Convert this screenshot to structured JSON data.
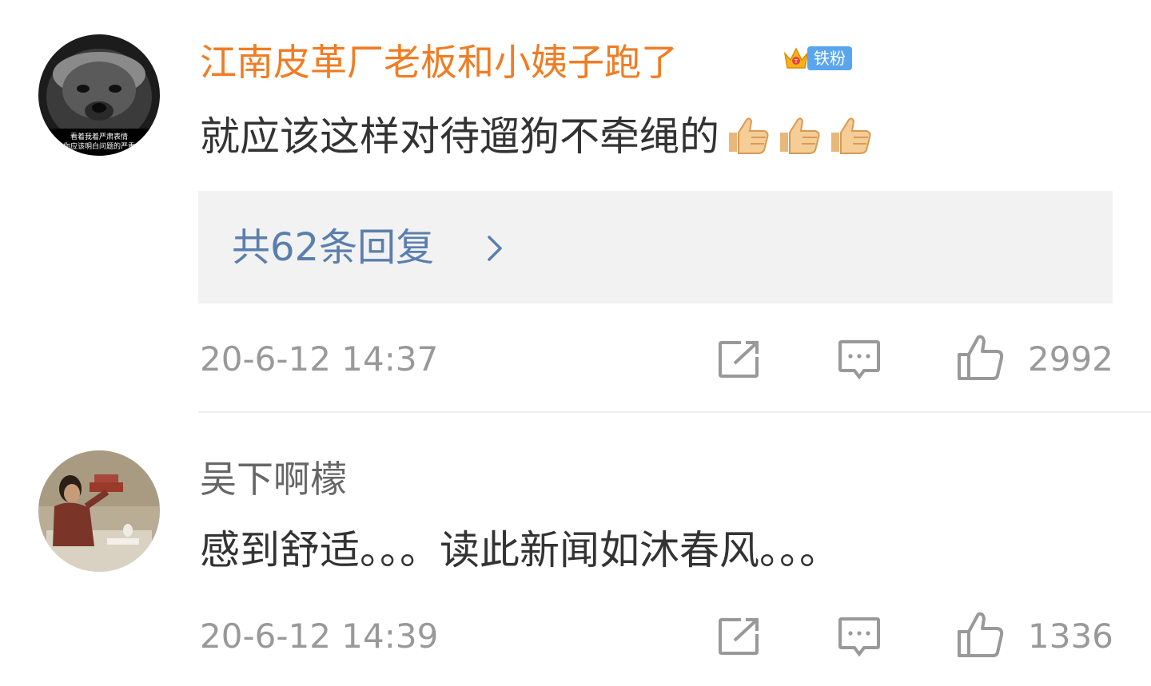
{
  "comments": [
    {
      "username": "江南皮革厂老板和小姨子跑了",
      "username_color": "#f07c24",
      "badge": {
        "label": "铁粉",
        "icon": "crown-icon"
      },
      "text": "就应该这样对待遛狗不牵绳的",
      "emojis": [
        "thumbs-up-emoji",
        "thumbs-up-emoji",
        "thumbs-up-emoji"
      ],
      "avatar_caption_line1": "看着我着严肃表情",
      "avatar_caption_line2": "你应该明白问题的严重",
      "replies_label": "共62条回复",
      "timestamp": "20-6-12 14:37",
      "likes": "2992"
    },
    {
      "username": "吴下啊檬",
      "username_color": "#666666",
      "text": "感到舒适。。。读此新闻如沐春风。。。",
      "timestamp": "20-6-12 14:39",
      "likes": "1336"
    }
  ],
  "icons": {
    "share": "share-icon",
    "comment": "comment-icon",
    "like": "thumbs-up-icon"
  },
  "colors": {
    "reply_link": "#5a7fae",
    "meta": "#999999",
    "badge_bg": "#5aa6ee"
  }
}
